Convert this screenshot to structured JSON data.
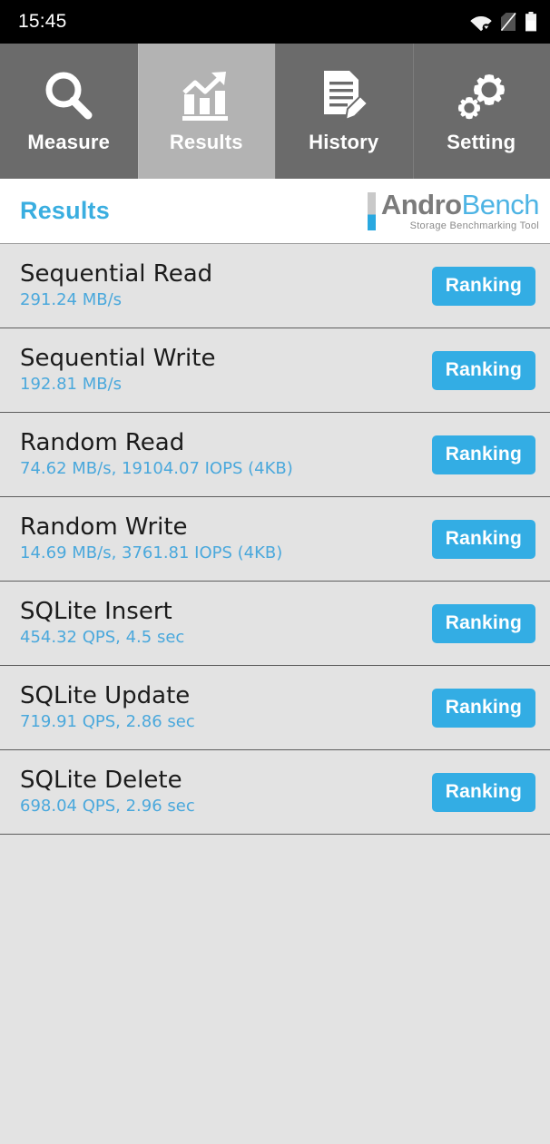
{
  "statusbar": {
    "time": "15:45",
    "icons": [
      {
        "name": "wifi-icon"
      },
      {
        "name": "no-sim-icon"
      },
      {
        "name": "battery-icon"
      }
    ]
  },
  "tabs": [
    {
      "label": "Measure",
      "icon": "magnifier-icon",
      "active": false
    },
    {
      "label": "Results",
      "icon": "bar-chart-arrow-icon",
      "active": true
    },
    {
      "label": "History",
      "icon": "document-pencil-icon",
      "active": false
    },
    {
      "label": "Setting",
      "icon": "gears-icon",
      "active": false
    }
  ],
  "header": {
    "title": "Results",
    "brand_primary": "Andro",
    "brand_secondary": "Bench",
    "brand_tagline": "Storage Benchmarking Tool"
  },
  "results": {
    "ranking_label": "Ranking",
    "rows": [
      {
        "title": "Sequential Read",
        "value": "291.24 MB/s"
      },
      {
        "title": "Sequential Write",
        "value": "192.81 MB/s"
      },
      {
        "title": "Random Read",
        "value": "74.62 MB/s, 19104.07 IOPS (4KB)"
      },
      {
        "title": "Random Write",
        "value": "14.69 MB/s, 3761.81 IOPS (4KB)"
      },
      {
        "title": "SQLite Insert",
        "value": "454.32 QPS, 4.5 sec"
      },
      {
        "title": "SQLite Update",
        "value": "719.91 QPS, 2.86 sec"
      },
      {
        "title": "SQLite Delete",
        "value": "698.04 QPS, 2.96 sec"
      }
    ]
  },
  "colors": {
    "accent_blue": "#33ade4",
    "value_blue": "#4aa8dc",
    "title_blue": "#3aaee0",
    "tab_bg": "#6b6b6b",
    "tab_active_bg": "#b3b3b3",
    "list_bg": "#e3e3e3"
  }
}
